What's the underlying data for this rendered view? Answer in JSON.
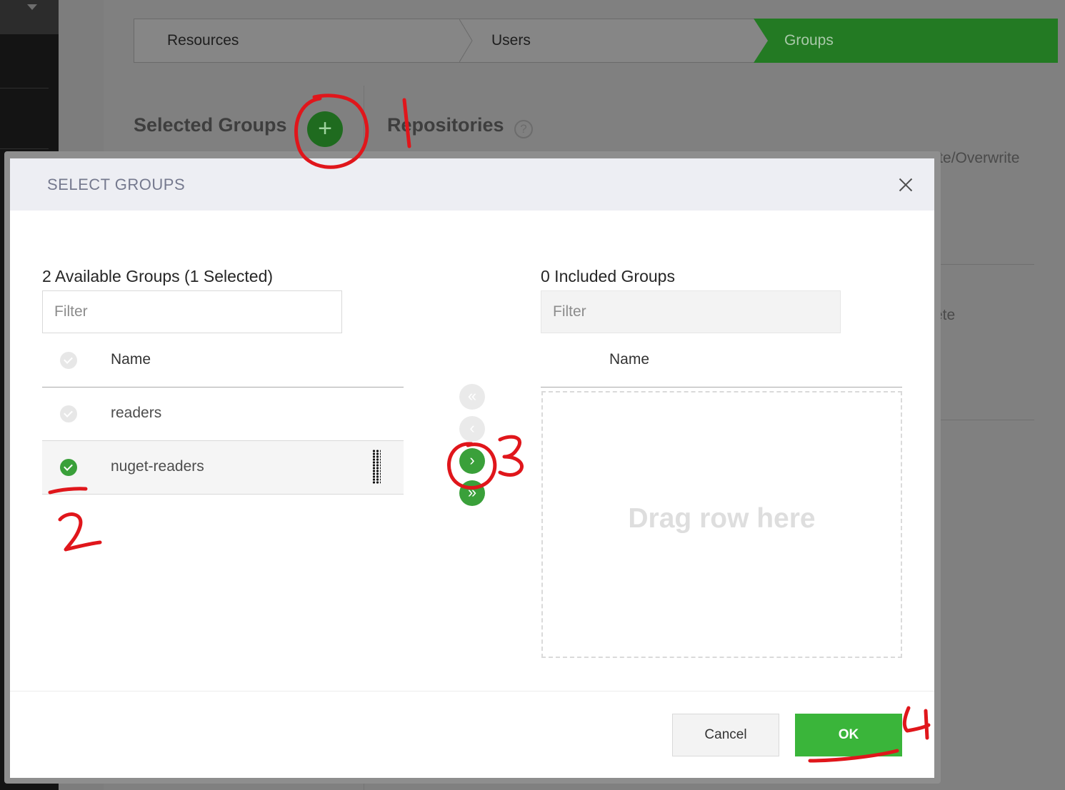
{
  "wizard": {
    "steps": [
      "Resources",
      "Users",
      "Groups"
    ],
    "active_step": "Groups"
  },
  "background": {
    "selected_groups_heading": "Selected Groups",
    "repositories_heading": "Repositories",
    "permission_partial": "Delete/Overwrite",
    "permission_tail": "ete"
  },
  "modal": {
    "title": "SELECT GROUPS",
    "available": {
      "title": "2 Available Groups (1 Selected)",
      "filter_placeholder": "Filter",
      "column_name": "Name",
      "rows": [
        {
          "name": "readers",
          "selected": false
        },
        {
          "name": "nuget-readers",
          "selected": true
        }
      ]
    },
    "included": {
      "title": "0 Included Groups",
      "filter_placeholder": "Filter",
      "column_name": "Name",
      "dropzone_text": "Drag row here"
    },
    "move_buttons": {
      "remove_all": "«",
      "remove_selected": "‹",
      "add_selected": "›",
      "add_all": "»"
    },
    "cancel_label": "Cancel",
    "ok_label": "OK"
  },
  "annotations": [
    "1",
    "2",
    "3",
    "4"
  ],
  "colors": {
    "accent_green": "#3aa03a",
    "ok_green": "#3ab53a",
    "annotation_red": "#e0161b",
    "header_bg": "#edeef3"
  },
  "icons": {
    "close": "close-icon",
    "check": "check-circle-icon",
    "grip": "drag-handle-icon",
    "plus": "plus-icon",
    "help": "help-icon"
  }
}
